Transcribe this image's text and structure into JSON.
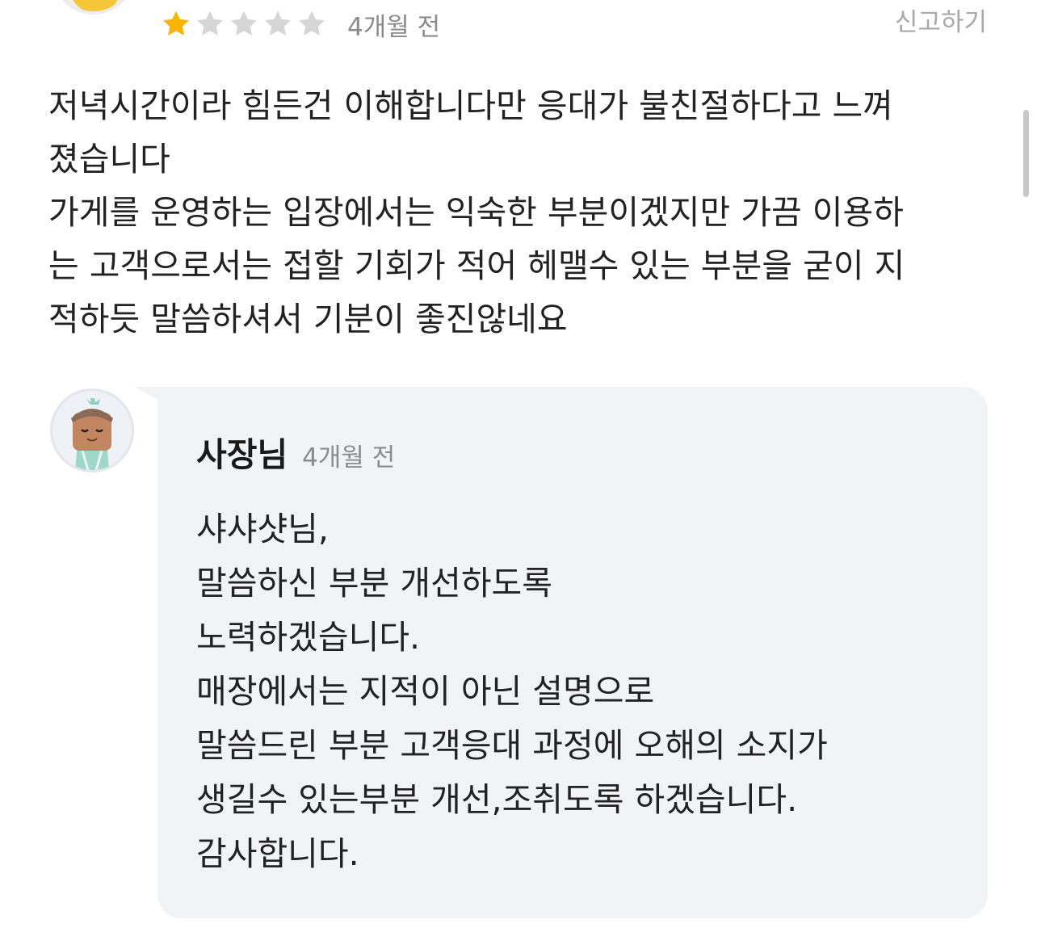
{
  "review": {
    "star_rating": 1,
    "star_count": 5,
    "time": "4개월 전",
    "report_label": "신고하기",
    "text": "저녁시간이라 힘든건 이해합니다만 응대가 불친절하다고 느껴\n졌습니다\n가게를 운영하는 입장에서는 익숙한 부분이겠지만 가끔 이용하\n는 고객으로서는 접할 기회가 적어 헤맬수 있는 부분을 굳이 지\n적하듯 말씀하셔서 기분이 좋진않네요"
  },
  "reply": {
    "owner_name": "사장님",
    "time": "4개월 전",
    "text": "샤샤샷님,\n말씀하신 부분 개선하도록\n노력하겠습니다.\n매장에서는 지적이 아닌 설명으로\n말씀드린 부분 고객응대 과정에 오해의 소지가\n생길수 있는부분 개선,조취도록 하겠습니다.\n감사합니다."
  },
  "colors": {
    "star_filled": "#f7b500",
    "star_empty": "#d6d6d6",
    "reply_background": "#f2f3f5"
  },
  "icons": {
    "reviewer_avatar": "reviewer-avatar",
    "owner_avatar": "owner-avatar",
    "star": "star-icon"
  }
}
